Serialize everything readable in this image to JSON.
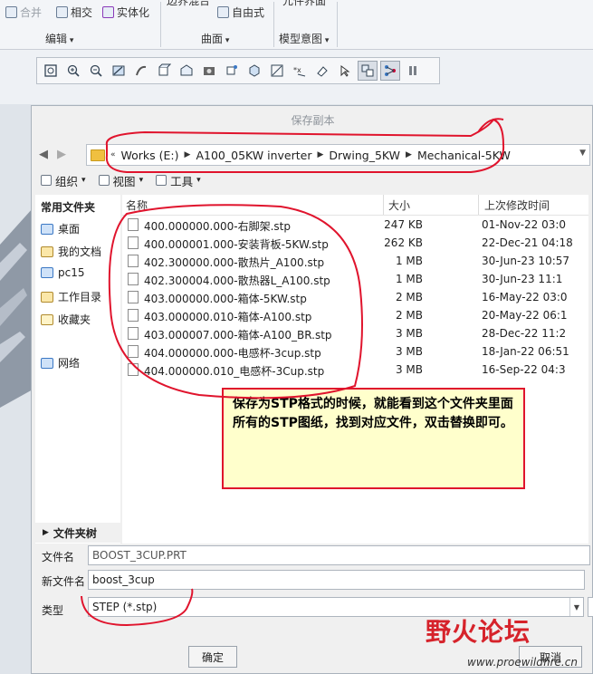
{
  "ribbon": {
    "edit_items": [
      {
        "label": "合并",
        "icon": "merge-icon",
        "dim": true
      },
      {
        "label": "相交",
        "icon": "intersect-icon",
        "dim": false
      },
      {
        "label": "实体化",
        "icon": "solidify-icon",
        "dim": false
      }
    ],
    "surface_top": "边界混合",
    "surface_item": "自由式",
    "model_top": "元件界面",
    "groups": [
      "编辑",
      "曲面",
      "模型意图"
    ]
  },
  "view_toolbar": {
    "icons": [
      "refit-icon",
      "zoom-in-icon",
      "zoom-out-icon",
      "repaint-icon",
      "shading-icon",
      "display-style-icon",
      "saved-view-icon",
      "named-view-icon",
      "view-manager-icon",
      "perspective-icon",
      "annotation-icon",
      "datum-display-icon",
      "spin-center-icon",
      "selection-icon",
      "network-icon",
      "pause-icon"
    ],
    "active": [
      13,
      14
    ]
  },
  "dialog": {
    "title": "保存副本",
    "breadcrumb": [
      "Works (E:)",
      "A100_05KW inverter",
      "Drwing_5KW",
      "Mechanical-5KW"
    ],
    "commands": {
      "organize": "组织",
      "view": "视图",
      "tools": "工具"
    },
    "sidebar": {
      "heading": "常用文件夹",
      "items": [
        {
          "label": "桌面",
          "icon": "desktop-icon"
        },
        {
          "label": "我的文档",
          "icon": "documents-icon"
        },
        {
          "label": "pc15",
          "icon": "computer-icon"
        },
        {
          "label": "工作目录",
          "icon": "working-directory-icon"
        },
        {
          "label": "收藏夹",
          "icon": "favorites-icon"
        },
        {
          "label": "网络",
          "icon": "network-icon"
        }
      ],
      "tree": "文件夹树"
    },
    "columns": {
      "name": "名称",
      "size": "大小",
      "modified": "上次修改时间"
    },
    "files": [
      {
        "name": "400.000000.000-右脚架.stp",
        "size": "247 KB",
        "modified": "01-Nov-22 03:0"
      },
      {
        "name": "400.000001.000-安装背板-5KW.stp",
        "size": "262 KB",
        "modified": "22-Dec-21 04:18"
      },
      {
        "name": "402.300000.000-散热片_A100.stp",
        "size": "1 MB",
        "modified": "30-Jun-23 10:57"
      },
      {
        "name": "402.300004.000-散热器L_A100.stp",
        "size": "1 MB",
        "modified": "30-Jun-23 11:1"
      },
      {
        "name": "403.000000.000-箱体-5KW.stp",
        "size": "2 MB",
        "modified": "16-May-22 03:0"
      },
      {
        "name": "403.000000.010-箱体-A100.stp",
        "size": "2 MB",
        "modified": "20-May-22 06:1"
      },
      {
        "name": "403.000007.000-箱体-A100_BR.stp",
        "size": "3 MB",
        "modified": "28-Dec-22 11:2"
      },
      {
        "name": "404.000000.000-电感杯-3cup.stp",
        "size": "3 MB",
        "modified": "18-Jan-22 06:51"
      },
      {
        "name": "404.000000.010_电感杯-3Cup.stp",
        "size": "3 MB",
        "modified": "16-Sep-22 04:3"
      }
    ],
    "fields": {
      "filename_label": "文件名",
      "filename_value": "BOOST_3CUP.PRT",
      "newname_label": "新文件名",
      "newname_value": "boost_3cup",
      "type_label": "类型",
      "type_value": "STEP (*.stp)"
    },
    "buttons": {
      "ok": "确定",
      "cancel": "取消"
    }
  },
  "annotation": {
    "text": "保存为STP格式的时候，就能看到这个文件夹里面所有的STP图纸，找到对应文件，双击替换即可。",
    "border_color": "#e0142d",
    "bg_color": "#ffffcc"
  },
  "watermark": {
    "title": "野火论坛",
    "url": "www.proewildfire.cn"
  }
}
